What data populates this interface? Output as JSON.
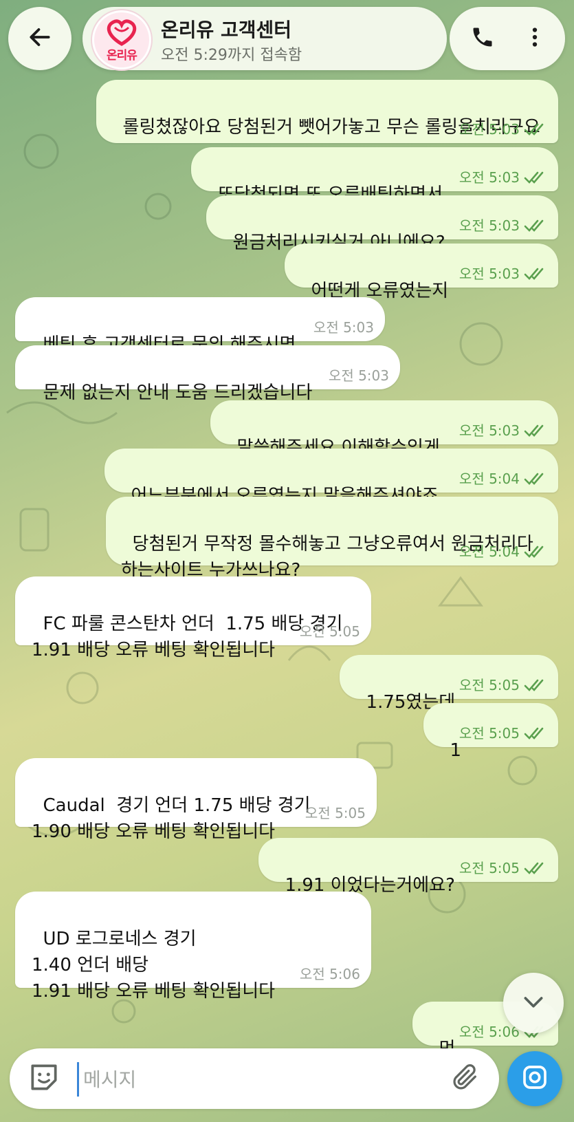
{
  "header": {
    "title": "온리유 고객센터",
    "status": "오전 5:29까지 접속함",
    "avatar_text": "온리유"
  },
  "messages": [
    {
      "dir": "out",
      "text": "롤링쳤잖아요 당첨된거 뺏어가놓고 무슨 롤링을치라구요",
      "time": "오전 5:03"
    },
    {
      "dir": "out",
      "text": "또당첨되면 또 오류배팅하면서",
      "time": "오전 5:03"
    },
    {
      "dir": "out",
      "text": "원금처리시키실거 아니에요?",
      "time": "오전 5:03"
    },
    {
      "dir": "out",
      "text": "어떤게 오류였는지",
      "time": "오전 5:03"
    },
    {
      "dir": "in",
      "text": "베팅 후 고객센터로 문의 해주시면",
      "time": "오전 5:03"
    },
    {
      "dir": "in",
      "text": "문제 없는지 안내 도움 드리겠습니다",
      "time": "오전 5:03"
    },
    {
      "dir": "out",
      "text": "말씀해주세요 이해할수있게",
      "time": "오전 5:03"
    },
    {
      "dir": "out",
      "text": "어느부분에서 오류였는지 말을해주셔야죠",
      "time": "오전 5:04"
    },
    {
      "dir": "out",
      "text": "당첨된거 무작정 몰수해놓고 그냥오류여서 원금처리다\n하는사이트 누가쓰나요?",
      "time": "오전 5:04"
    },
    {
      "dir": "in",
      "text": "FC 파룰 콘스탄차 언더  1.75 배당 경기\n1.91 배당 오류 베팅 확인됩니다",
      "time": "오전 5:05"
    },
    {
      "dir": "out",
      "text": "1.75였는데",
      "time": "오전 5:05"
    },
    {
      "dir": "out",
      "text": "1",
      "time": "오전 5:05"
    },
    {
      "dir": "in",
      "text": "Caudal  경기 언더 1.75 배당 경기\n1.90 배당 오류 베팅 확인됩니다",
      "time": "오전 5:05"
    },
    {
      "dir": "out",
      "text": "1.91 이었다는거에요?",
      "time": "오전 5:05"
    },
    {
      "dir": "in",
      "text": "UD 로그로네스 경기\n1.40 언더 배당\n1.91 배당 오류 베팅 확인됩니다",
      "time": "오전 5:06"
    },
    {
      "dir": "out",
      "text": "먼",
      "time": "오전 5:06"
    }
  ],
  "composer": {
    "placeholder": "메시지"
  },
  "colors": {
    "outgoing_bubble": "#eefbd8",
    "incoming_bubble": "#ffffff",
    "accent": "#2b9ee8",
    "read_ticks": "#5aa04e"
  },
  "icons": [
    "back-arrow-icon",
    "phone-icon",
    "more-vertical-icon",
    "chevron-down-icon",
    "sticker-icon",
    "paperclip-icon",
    "camera-icon"
  ]
}
